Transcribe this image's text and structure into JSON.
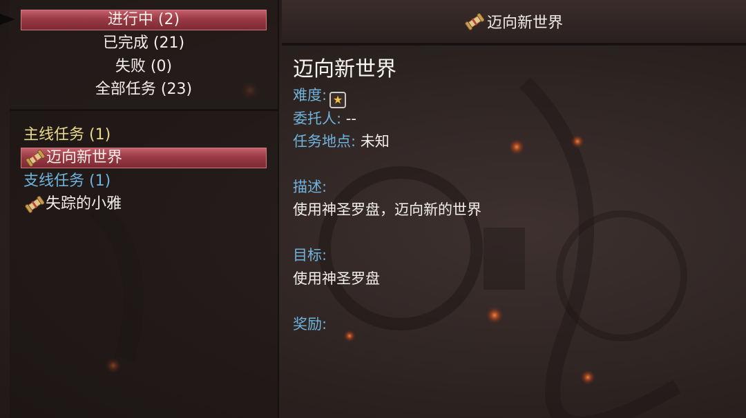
{
  "filters": [
    {
      "label": "进行中 (2)",
      "selected": true
    },
    {
      "label": "已完成 (21)",
      "selected": false
    },
    {
      "label": "失败 (0)",
      "selected": false
    },
    {
      "label": "全部任务 (23)",
      "selected": false
    }
  ],
  "categories": {
    "main": {
      "label": "主线任务 (1)"
    },
    "side": {
      "label": "支线任务 (1)"
    }
  },
  "quests": {
    "main_quest": {
      "label": "迈向新世界",
      "icon": "scroll-icon",
      "selected": true
    },
    "side_quest": {
      "label": "失踪的小雅",
      "icon": "scroll-icon",
      "selected": false
    }
  },
  "header": {
    "title": "迈向新世界",
    "icon": "scroll-icon"
  },
  "detail": {
    "title": "迈向新世界",
    "difficulty_label": "难度:",
    "difficulty_icon": "star-icon",
    "client_label": "委托人:",
    "client_value": "--",
    "location_label": "任务地点:",
    "location_value": "未知",
    "description_label": "描述:",
    "description_text": "使用神圣罗盘，迈向新的世界",
    "objective_label": "目标:",
    "objective_text": "使用神圣罗盘",
    "reward_label": "奖励:"
  },
  "colors": {
    "selection": "#9a3a44",
    "label_blue": "#6fb4dc",
    "main_category_yellow": "#e9d98a"
  }
}
